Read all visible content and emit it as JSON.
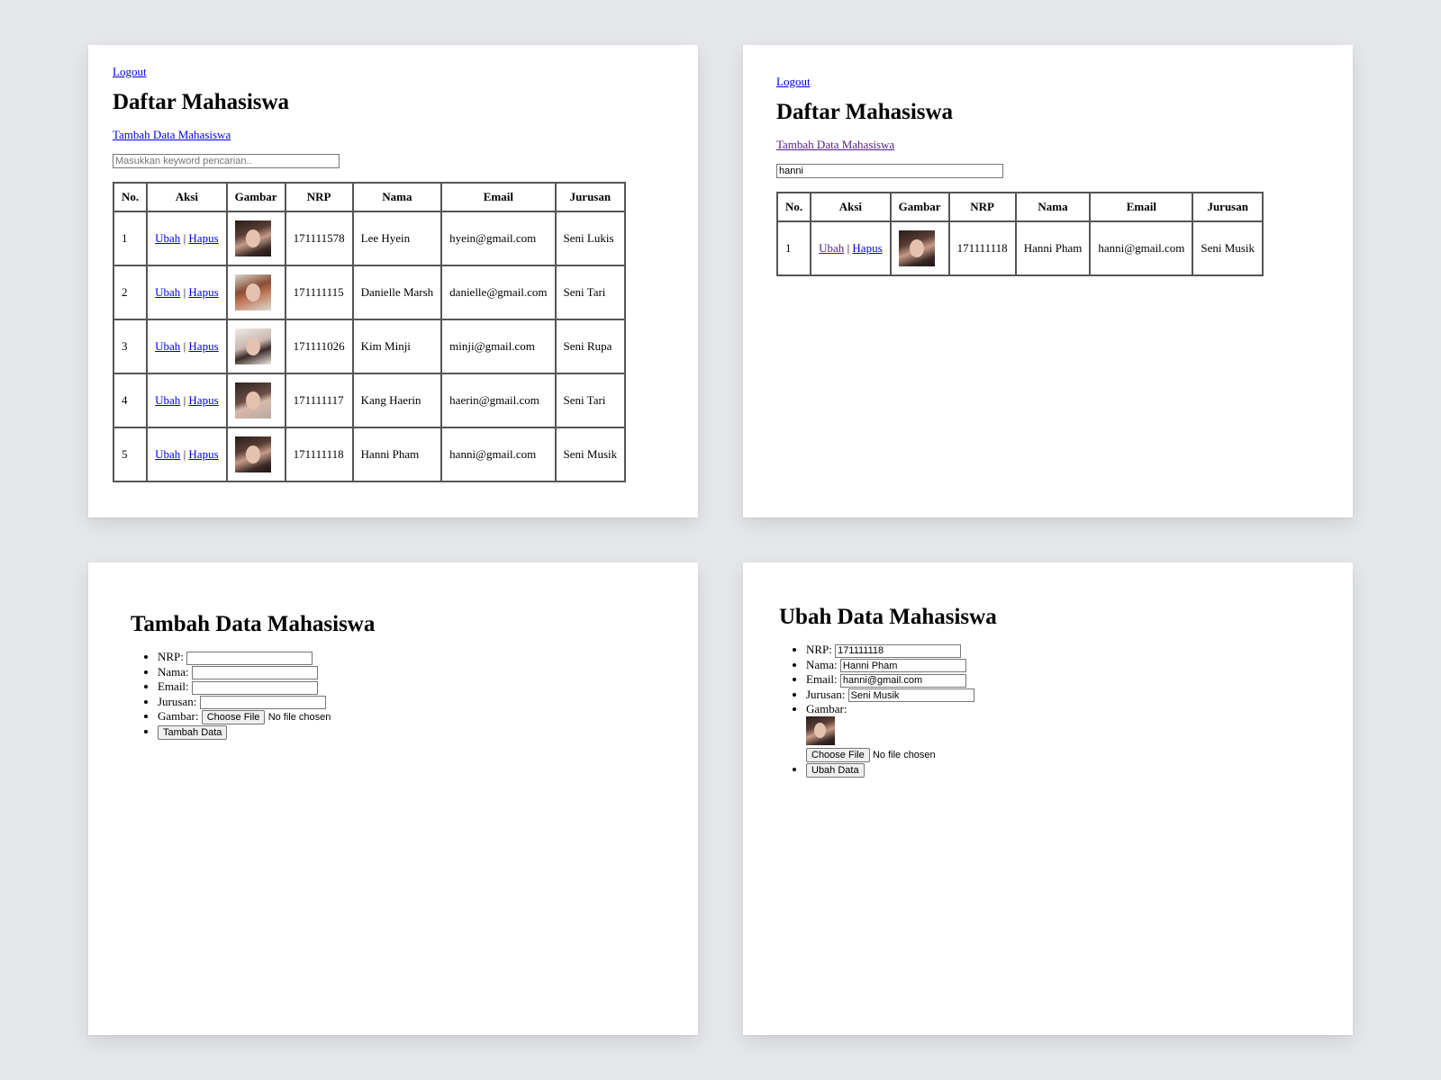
{
  "list_all": {
    "logout": "Logout",
    "title": "Daftar Mahasiswa",
    "add_link": "Tambah Data Mahasiswa",
    "search_placeholder": "Masukkan keyword pencarian..",
    "search_value": "",
    "headers": [
      "No.",
      "Aksi",
      "Gambar",
      "NRP",
      "Nama",
      "Email",
      "Jurusan"
    ],
    "edit_label": "Ubah",
    "delete_label": "Hapus",
    "separator": "|",
    "rows": [
      {
        "no": "1",
        "nrp": "171111578",
        "nama": "Lee Hyein",
        "email": "hyein@gmail.com",
        "jurusan": "Seni Lukis",
        "photo": "student-photo"
      },
      {
        "no": "2",
        "nrp": "171111115",
        "nama": "Danielle Marsh",
        "email": "danielle@gmail.com",
        "jurusan": "Seni Tari",
        "photo": "student-photo"
      },
      {
        "no": "3",
        "nrp": "171111026",
        "nama": "Kim Minji",
        "email": "minji@gmail.com",
        "jurusan": "Seni Rupa",
        "photo": "student-photo"
      },
      {
        "no": "4",
        "nrp": "171111117",
        "nama": "Kang Haerin",
        "email": "haerin@gmail.com",
        "jurusan": "Seni Tari",
        "photo": "student-photo"
      },
      {
        "no": "5",
        "nrp": "171111118",
        "nama": "Hanni Pham",
        "email": "hanni@gmail.com",
        "jurusan": "Seni Musik",
        "photo": "student-photo"
      }
    ]
  },
  "list_search": {
    "logout": "Logout",
    "title": "Daftar Mahasiswa",
    "add_link": "Tambah Data Mahasiswa",
    "search_value": "hanni",
    "headers": [
      "No.",
      "Aksi",
      "Gambar",
      "NRP",
      "Nama",
      "Email",
      "Jurusan"
    ],
    "edit_label": "Ubah",
    "delete_label": "Hapus",
    "separator": "|",
    "rows": [
      {
        "no": "1",
        "nrp": "171111118",
        "nama": "Hanni Pham",
        "email": "hanni@gmail.com",
        "jurusan": "Seni Musik",
        "photo": "student-photo"
      }
    ]
  },
  "add_form": {
    "title": "Tambah Data Mahasiswa",
    "nrp_label": "NRP:",
    "nama_label": "Nama:",
    "email_label": "Email:",
    "jurusan_label": "Jurusan:",
    "gambar_label": "Gambar:",
    "choose_file": "Choose File",
    "no_file": "No file chosen",
    "submit": "Tambah Data"
  },
  "edit_form": {
    "title": "Ubah Data Mahasiswa",
    "nrp_label": "NRP:",
    "nrp_value": "171111118",
    "nama_label": "Nama:",
    "nama_value": "Hanni Pham",
    "email_label": "Email:",
    "email_value": "hanni@gmail.com",
    "jurusan_label": "Jurusan:",
    "jurusan_value": "Seni Musik",
    "gambar_label": "Gambar:",
    "choose_file": "Choose File",
    "no_file": "No file chosen",
    "submit": "Ubah Data"
  }
}
